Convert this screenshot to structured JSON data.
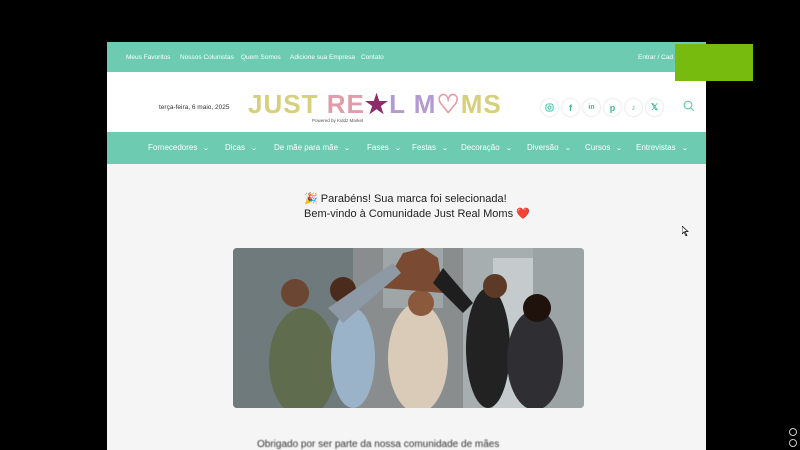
{
  "topbar": {
    "links": [
      "Meus Favoritos",
      "Nossos Colunistas",
      "Quem Somos",
      "Adicione sua Empresa",
      "Contato"
    ],
    "login": "Entrar / Cad"
  },
  "header": {
    "date": "terça-feira, 6 maio, 2025",
    "logo": "JUST REAL MOMS",
    "powered_by": "Powered by Kiddz Market",
    "social_icons": [
      "instagram-icon",
      "facebook-icon",
      "linkedin-icon",
      "pinterest-icon",
      "tiktok-icon",
      "x-icon"
    ]
  },
  "nav": {
    "items": [
      "Fornecedores",
      "Dicas",
      "De mãe para mãe",
      "Fases",
      "Festas",
      "Decoração",
      "Diversão",
      "Cursos",
      "Entrevistas"
    ]
  },
  "main": {
    "headline_line1": "🎉 Parabéns! Sua marca foi selecionada!",
    "headline_line2": "Bem-vindo à Comunidade Just Real Moms ❤️",
    "bottom_text": "Obrigado por ser parte da nossa comunidade de mães",
    "hero_image": "group-high-five-photo"
  },
  "colors": {
    "brand_teal": "#6ccbb0",
    "overlay_green": "#77bb0f",
    "page_bg": "#f5f5f5"
  }
}
